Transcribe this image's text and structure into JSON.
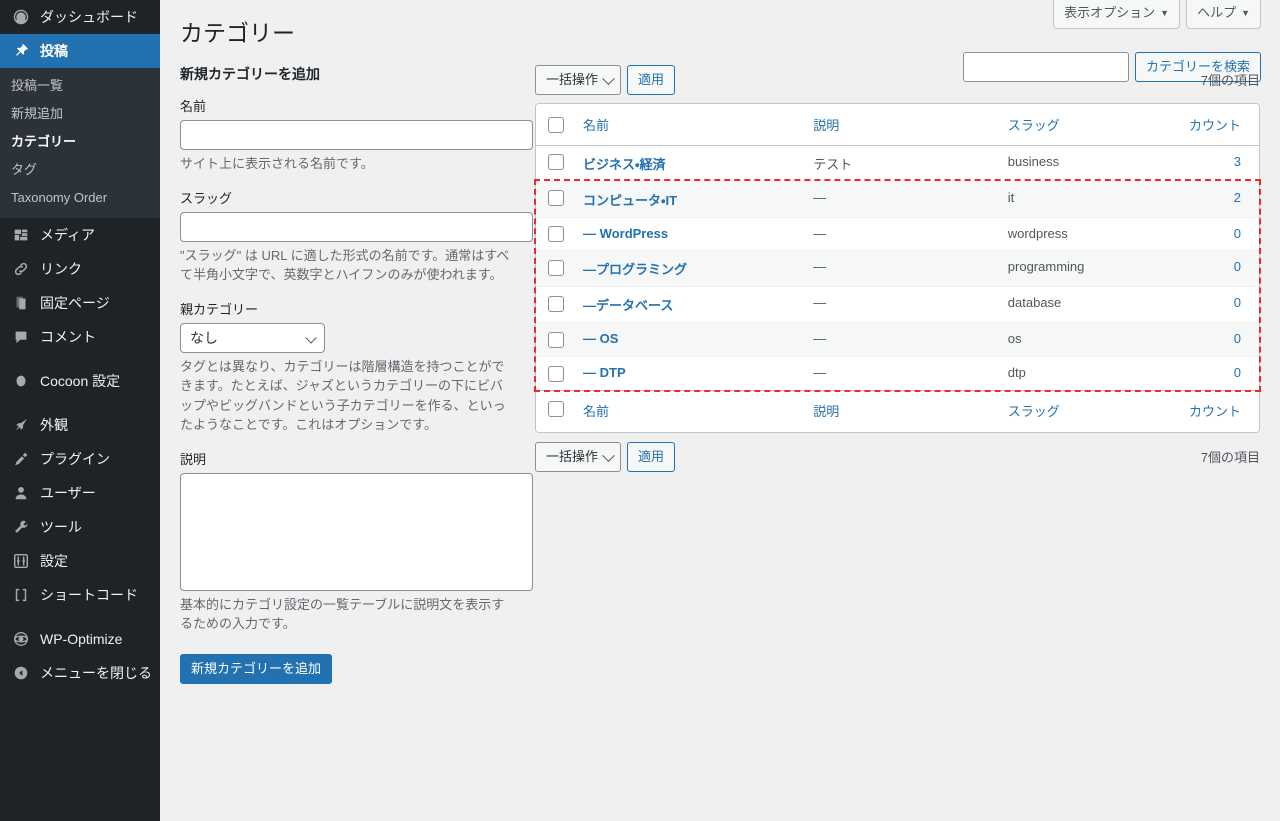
{
  "sidebar": {
    "items": [
      {
        "label": "ダッシュボード",
        "icon": "dashboard-icon",
        "state": "normal"
      },
      {
        "label": "投稿",
        "icon": "pin-icon",
        "state": "current"
      },
      {
        "label": "メディア",
        "icon": "media-icon",
        "state": "normal"
      },
      {
        "label": "リンク",
        "icon": "link-icon",
        "state": "normal"
      },
      {
        "label": "固定ページ",
        "icon": "page-icon",
        "state": "normal"
      },
      {
        "label": "コメント",
        "icon": "comment-icon",
        "state": "normal"
      },
      {
        "label": "Cocoon 設定",
        "icon": "cocoon-icon",
        "state": "normal"
      },
      {
        "label": "外観",
        "icon": "appearance-icon",
        "state": "normal"
      },
      {
        "label": "プラグイン",
        "icon": "plugin-icon",
        "state": "normal"
      },
      {
        "label": "ユーザー",
        "icon": "user-icon",
        "state": "normal"
      },
      {
        "label": "ツール",
        "icon": "tools-icon",
        "state": "normal"
      },
      {
        "label": "設定",
        "icon": "settings-icon",
        "state": "normal"
      },
      {
        "label": "ショートコード",
        "icon": "shortcode-icon",
        "state": "normal"
      },
      {
        "label": "WP-Optimize",
        "icon": "optimize-icon",
        "state": "normal"
      },
      {
        "label": "メニューを閉じる",
        "icon": "collapse-icon",
        "state": "normal"
      }
    ],
    "submenu": [
      {
        "label": "投稿一覧",
        "current": false
      },
      {
        "label": "新規追加",
        "current": false
      },
      {
        "label": "カテゴリー",
        "current": true
      },
      {
        "label": "タグ",
        "current": false
      },
      {
        "label": "Taxonomy Order",
        "current": false
      }
    ]
  },
  "screen_meta": {
    "screen_options": "表示オプション",
    "help": "ヘルプ",
    "caret": "▼"
  },
  "header": {
    "page_title": "カテゴリー"
  },
  "search": {
    "value": "",
    "placeholder": "",
    "button_label": "カテゴリーを検索"
  },
  "form": {
    "heading": "新規カテゴリーを追加",
    "name": {
      "label": "名前",
      "value": "",
      "description": "サイト上に表示される名前です。"
    },
    "slug": {
      "label": "スラッグ",
      "value": "",
      "description": "\"スラッグ\" は URL に適した形式の名前です。通常はすべて半角小文字で、英数字とハイフンのみが使われます。"
    },
    "parent": {
      "label": "親カテゴリー",
      "selected": "なし",
      "options": [
        "なし"
      ],
      "description": "タグとは異なり、カテゴリーは階層構造を持つことができます。たとえば、ジャズというカテゴリーの下にビバップやビッグバンドという子カテゴリーを作る、といったようなことです。これはオプションです。"
    },
    "description": {
      "label": "説明",
      "value": "",
      "description": "基本的にカテゴリ設定の一覧テーブルに説明文を表示するための入力です。"
    },
    "submit_label": "新規カテゴリーを追加"
  },
  "tablenav": {
    "bulk_action_label": "一括操作",
    "apply_label": "適用",
    "count_top": "7個の項目",
    "count_bottom": "7個の項目"
  },
  "table": {
    "columns": {
      "name": "名前",
      "description": "説明",
      "slug": "スラッグ",
      "count": "カウント"
    },
    "rows": [
      {
        "name": "ビジネス・経済",
        "description": "テスト",
        "slug": "business",
        "count": "3",
        "highlighted": false
      },
      {
        "name": "コンピュータ・IT",
        "description": "—",
        "slug": "it",
        "count": "2",
        "highlighted": true
      },
      {
        "name": "— WordPress",
        "description": "—",
        "slug": "wordpress",
        "count": "0",
        "highlighted": true
      },
      {
        "name": "—プログラミング",
        "description": "—",
        "slug": "programming",
        "count": "0",
        "highlighted": true
      },
      {
        "name": "—データベース",
        "description": "—",
        "slug": "database",
        "count": "0",
        "highlighted": true
      },
      {
        "name": "— OS",
        "description": "—",
        "slug": "os",
        "count": "0",
        "highlighted": true
      },
      {
        "name": "— DTP",
        "description": "—",
        "slug": "dtp",
        "count": "0",
        "highlighted": true
      }
    ]
  },
  "colors": {
    "sidebar_bg": "#1d2327",
    "submenu_bg": "#2c3338",
    "accent": "#2271b1",
    "highlight_outline": "#ef2929",
    "page_bg": "#f0f0f1",
    "row_alt_bg": "#f6f7f7"
  }
}
